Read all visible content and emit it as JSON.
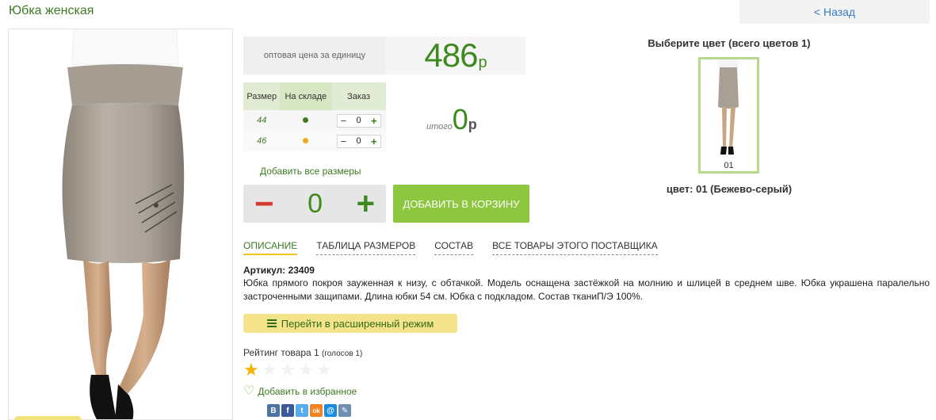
{
  "page": {
    "title": "Юбка женская",
    "back_label": "< Назад"
  },
  "price": {
    "label": "оптовая цена за единицу",
    "value": "486",
    "currency": "р"
  },
  "size_table": {
    "headers": [
      "Размер",
      "На складе",
      "Заказ"
    ],
    "rows": [
      {
        "size": "44",
        "stock_color": "#3e7a22",
        "qty": "0"
      },
      {
        "size": "46",
        "stock_color": "#f5a623",
        "qty": "0"
      }
    ],
    "minus": "−",
    "plus": "+"
  },
  "total": {
    "label": "итого",
    "value": "0",
    "currency": "р"
  },
  "add_all_sizes": "Добавить все размеры",
  "quantity": {
    "minus": "−",
    "value": "0",
    "plus": "+"
  },
  "add_to_cart": "ДОБАВИТЬ В КОРЗИНУ",
  "colors": {
    "title": "Выберите цвет (всего цветов 1)",
    "items": [
      {
        "code": "01"
      }
    ],
    "selected": "цвет: 01 (Бежево-серый)"
  },
  "tabs": [
    "ОПИСАНИЕ",
    "ТАБЛИЦА РАЗМЕРОВ",
    "СОСТАВ",
    "ВСЕ ТОВАРЫ ЭТОГО ПОСТАВЩИКА"
  ],
  "article": "Артикул: 23409",
  "description": "Юбка прямого покроя зауженная к низу, с обтачкой. Модель оснащена застёжкой на молнию и шлицей в среднем шве. Юбка украшена паралельно застроченными защипами. Длина юбки 54 см. Юбка с подкладом. Состав тканиП/Э 100%.",
  "advanced_mode": "Перейти в расширенный режим",
  "rating": {
    "label": "Рейтинг товара 1",
    "votes": "(голосов 1)",
    "stars": 1,
    "max": 5
  },
  "favorite": "Добавить в избранное",
  "social": [
    {
      "name": "vkontakte-icon",
      "glyph": "В",
      "color": "#4c75a3"
    },
    {
      "name": "facebook-icon",
      "glyph": "f",
      "color": "#3b5998"
    },
    {
      "name": "twitter-icon",
      "glyph": "t",
      "color": "#55acee"
    },
    {
      "name": "odnoklassniki-icon",
      "glyph": "ok",
      "color": "#f58220"
    },
    {
      "name": "mailru-icon",
      "glyph": "@",
      "color": "#168de2"
    },
    {
      "name": "livejournal-icon",
      "glyph": "✎",
      "color": "#6f8fb3"
    }
  ]
}
